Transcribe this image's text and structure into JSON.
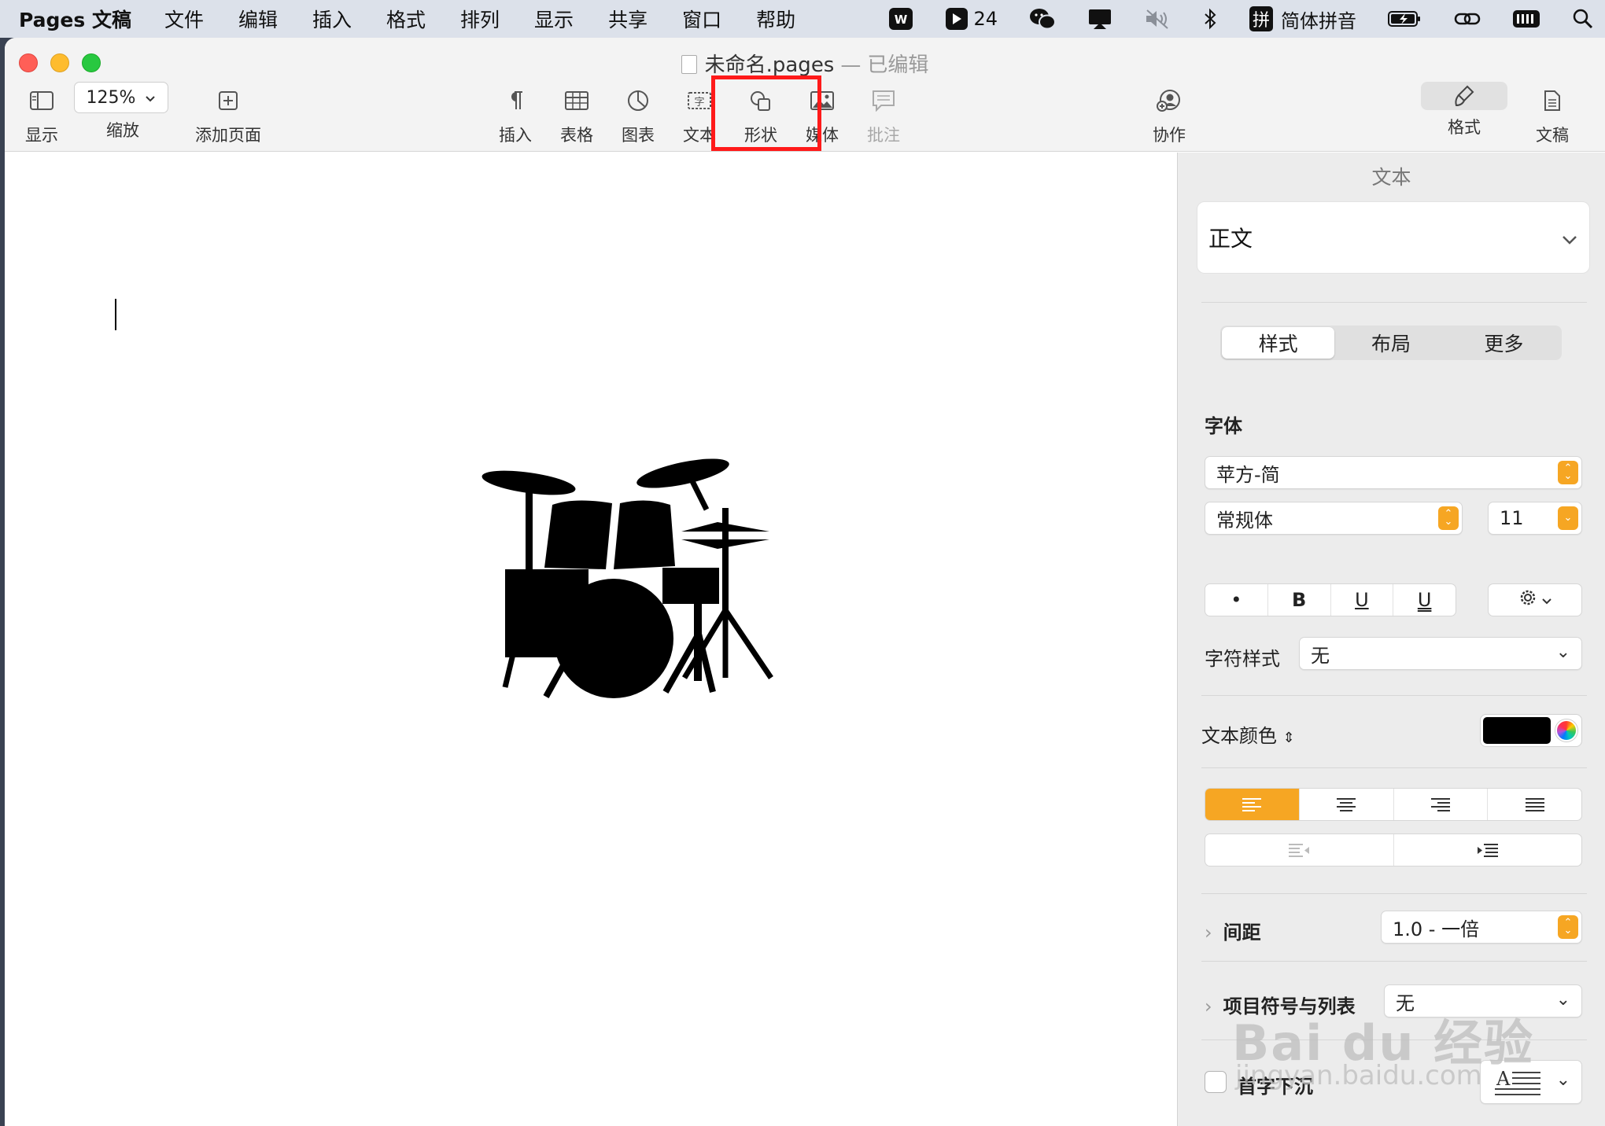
{
  "menubar": {
    "app": "Pages 文稿",
    "items": [
      "文件",
      "编辑",
      "插入",
      "格式",
      "排列",
      "显示",
      "共享",
      "窗口",
      "帮助"
    ],
    "status": {
      "badge_count": "24",
      "ime_label": "简体拼音",
      "ime_glyph": "拼"
    }
  },
  "window": {
    "title": "未命名.pages",
    "title_sep": "—",
    "edited": "已编辑"
  },
  "toolbar": {
    "view": "显示",
    "zoom_value": "125%",
    "zoom": "缩放",
    "add_page": "添加页面",
    "insert": "插入",
    "table": "表格",
    "chart": "图表",
    "text": "文本",
    "shape": "形状",
    "media": "媒体",
    "comment": "批注",
    "collaborate": "协作",
    "format": "格式",
    "document": "文稿"
  },
  "inspector": {
    "header": "文本",
    "paragraph_style": "正文",
    "tabs": [
      "样式",
      "布局",
      "更多"
    ],
    "font_label": "字体",
    "font_family": "苹方-简",
    "font_style": "常规体",
    "font_size": "11",
    "bold": "B",
    "underline": "U",
    "char_style_label": "字符样式",
    "char_style_value": "无",
    "text_color_label": "文本颜色",
    "text_color": "#000000",
    "spacing_label": "间距",
    "spacing_value": "1.0 - 一倍",
    "bullets_label": "项目符号与列表",
    "bullets_value": "无",
    "dropcap_label": "首字下沉"
  },
  "watermark": {
    "line1": "Bai du 经验",
    "line2": "jingyan.baidu.com"
  },
  "colors": {
    "accent": "#f6a623",
    "highlight": "#ff1a1a"
  }
}
